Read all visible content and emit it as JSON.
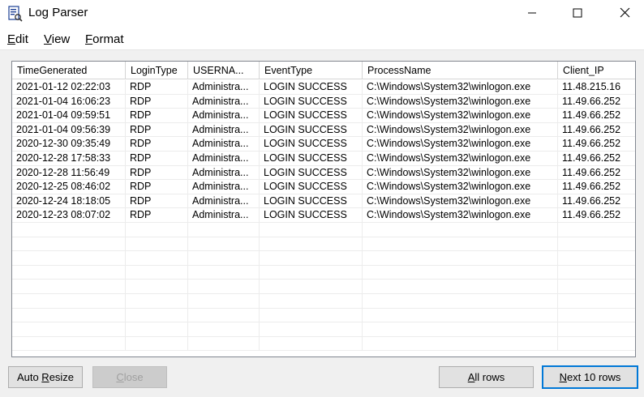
{
  "window": {
    "title": "Log Parser"
  },
  "menu": [
    {
      "accel": "E",
      "rest": "dit"
    },
    {
      "accel": "V",
      "rest": "iew"
    },
    {
      "accel": "F",
      "rest": "ormat"
    }
  ],
  "table": {
    "columns": [
      "TimeGenerated",
      "LoginType",
      "USERNA...",
      "EventType",
      "ProcessName",
      "Client_IP"
    ],
    "rows": [
      [
        "2021-01-12 02:22:03",
        "RDP",
        "Administra...",
        "LOGIN SUCCESS",
        "C:\\Windows\\System32\\winlogon.exe",
        "11.48.215.16"
      ],
      [
        "2021-01-04 16:06:23",
        "RDP",
        "Administra...",
        "LOGIN SUCCESS",
        "C:\\Windows\\System32\\winlogon.exe",
        "11.49.66.252"
      ],
      [
        "2021-01-04 09:59:51",
        "RDP",
        "Administra...",
        "LOGIN SUCCESS",
        "C:\\Windows\\System32\\winlogon.exe",
        "11.49.66.252"
      ],
      [
        "2021-01-04 09:56:39",
        "RDP",
        "Administra...",
        "LOGIN SUCCESS",
        "C:\\Windows\\System32\\winlogon.exe",
        "11.49.66.252"
      ],
      [
        "2020-12-30 09:35:49",
        "RDP",
        "Administra...",
        "LOGIN SUCCESS",
        "C:\\Windows\\System32\\winlogon.exe",
        "11.49.66.252"
      ],
      [
        "2020-12-28 17:58:33",
        "RDP",
        "Administra...",
        "LOGIN SUCCESS",
        "C:\\Windows\\System32\\winlogon.exe",
        "11.49.66.252"
      ],
      [
        "2020-12-28 11:56:49",
        "RDP",
        "Administra...",
        "LOGIN SUCCESS",
        "C:\\Windows\\System32\\winlogon.exe",
        "11.49.66.252"
      ],
      [
        "2020-12-25 08:46:02",
        "RDP",
        "Administra...",
        "LOGIN SUCCESS",
        "C:\\Windows\\System32\\winlogon.exe",
        "11.49.66.252"
      ],
      [
        "2020-12-24 18:18:05",
        "RDP",
        "Administra...",
        "LOGIN SUCCESS",
        "C:\\Windows\\System32\\winlogon.exe",
        "11.49.66.252"
      ],
      [
        "2020-12-23 08:07:02",
        "RDP",
        "Administra...",
        "LOGIN SUCCESS",
        "C:\\Windows\\System32\\winlogon.exe",
        "11.49.66.252"
      ]
    ]
  },
  "buttons": {
    "auto_resize": {
      "accel": "R",
      "before": "Auto ",
      "after": "esize"
    },
    "close": {
      "accel": "C",
      "before": "",
      "after": "lose"
    },
    "all_rows": {
      "accel": "A",
      "before": "",
      "after": "ll rows"
    },
    "next_rows": {
      "accel": "N",
      "before": "",
      "after": "ext 10 rows"
    }
  },
  "colors": {
    "focus_border": "#0078d7",
    "disabled_text": "#a0a0a0"
  }
}
